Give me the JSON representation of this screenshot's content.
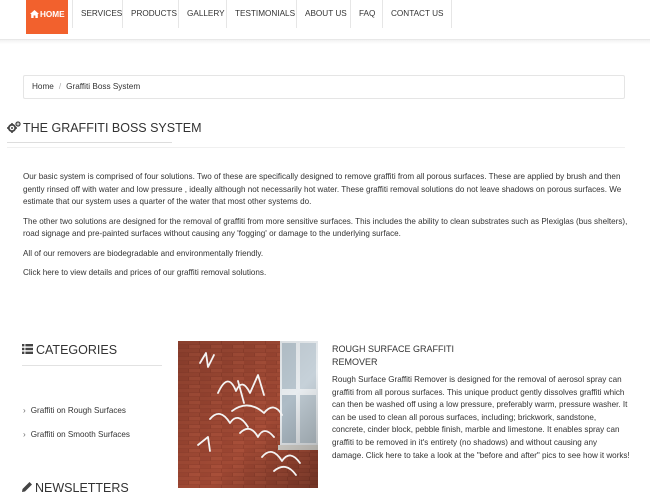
{
  "nav": {
    "items": [
      {
        "label": "HOME"
      },
      {
        "label": "SERVICES"
      },
      {
        "label": "PRODUCTS"
      },
      {
        "label": "GALLERY"
      },
      {
        "label": "TESTIMONIALS"
      },
      {
        "label": "ABOUT US"
      },
      {
        "label": "FAQ"
      },
      {
        "label": "CONTACT US"
      }
    ],
    "accent_color": "#f2612d"
  },
  "breadcrumb": {
    "home": "Home",
    "current": "Graffiti Boss System"
  },
  "page": {
    "title": "THE GRAFFITI BOSS SYSTEM",
    "paragraphs": [
      "Our basic system is comprised of four solutions. Two of these are specifically designed to remove graffiti from all porous surfaces. These are applied by brush and then gently rinsed off with water and low pressure , ideally although not necessarily hot water. These graffiti removal solutions do not leave shadows on porous surfaces. We estimate that our system uses a quarter of the water that most other systems do.",
      "The other two solutions are designed for the removal of graffiti from more sensitive surfaces. This includes the ability to clean substrates such as Plexiglas (bus shelters), road signage and pre-painted surfaces without causing any 'fogging' or damage to the underlying surface.",
      "All of our removers are biodegradable and environmentally friendly.",
      "Click here to view details and prices of our graffiti removal solutions."
    ]
  },
  "sidebar": {
    "categories_title": "CATEGORIES",
    "categories": [
      {
        "label": "Graffiti on Rough Surfaces"
      },
      {
        "label": "Graffiti on Smooth Surfaces"
      }
    ],
    "newsletters_title": "NEWSLETTERS"
  },
  "product": {
    "title": "ROUGH SURFACE GRAFFITI REMOVER",
    "description": "Rough Surface Graffiti Remover is designed for the removal of aerosol spray can graffiti from all porous surfaces. This unique product gently dissolves graffiti which can then be washed off using a low pressure, preferably warm, pressure washer. It can be used to clean all porous surfaces, including; brickwork, sandstone, concrete, cinder block, pebble finish, marble and limestone. It enables spray can graffiti to be removed in it's entirety (no shadows) and without causing any damage. Click here to take a look at the \"before and after\" pics to see how it works!",
    "image_icon": "graffiti-brick-wall-photo"
  }
}
